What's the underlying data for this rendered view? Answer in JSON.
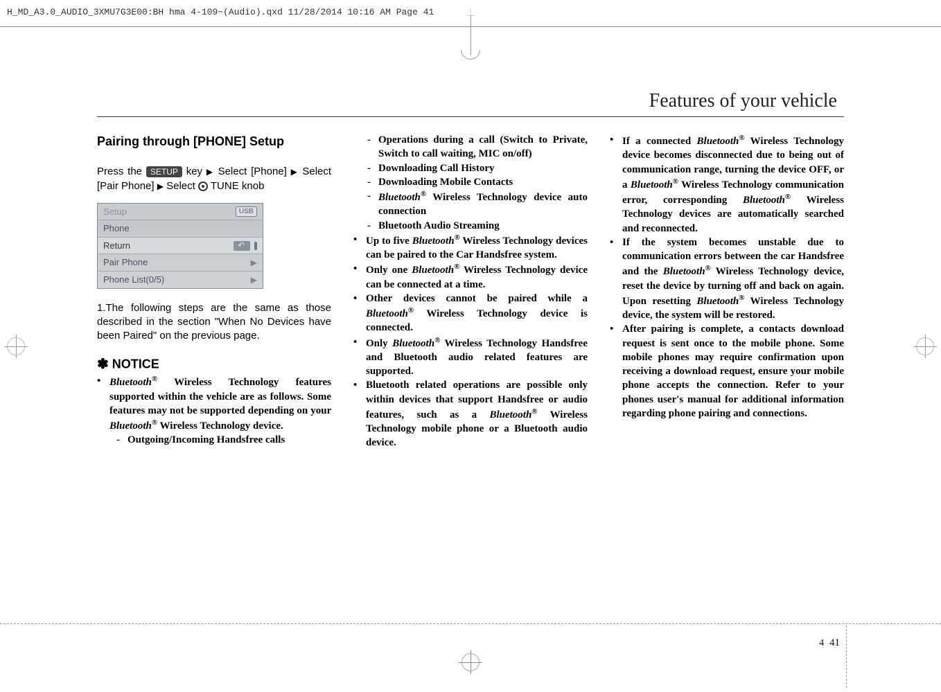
{
  "print_header": "H_MD_A3.0_AUDIO_3XMU7G3E00:BH hma 4-109~(Audio).qxd  11/28/2014  10:16 AM  Page 41",
  "section_title": "Features of your vehicle",
  "col1": {
    "heading": "Pairing through [PHONE] Setup",
    "press_pre": "Press the ",
    "setup_key": "SETUP",
    "press_after_key": " key ",
    "select1": "Select [Phone]",
    "select2": "Select [Pair Phone] ",
    "select3": "Select ",
    "tune_knob": "TUNE knob",
    "screenshot": {
      "title": "Setup",
      "usb": "USB",
      "phone": "Phone",
      "ret": "Return",
      "pair": "Pair Phone",
      "list": "Phone List(0/5)"
    },
    "step1": "1.The following steps are the same as those described in the section \"When No Devices have been Paired\" on the previous page.",
    "notice": "NOTICE",
    "b1_pre": "Bluetooth",
    "b1_post": " Wireless Technology features supported within the vehicle are as follows. Some features may not be supported depending on your ",
    "b1_bt2": "Bluetooth",
    "b1_tail": " Wireless Technology device.",
    "s1": "Outgoing/Incoming Handsfree calls"
  },
  "col2": {
    "s2": "Operations during a call (Switch to Private, Switch to call waiting, MIC on/off)",
    "s3": "Downloading Call History",
    "s4": "Downloading Mobile Contacts",
    "s5_pre": "Bluetooth",
    "s5_post": " Wireless Technology device auto connection",
    "s6": "Bluetooth Audio Streaming",
    "b2_pre": "Up to five ",
    "b2_bt": "Bluetooth",
    "b2_post": " Wireless Technology devices can be paired to the Car Handsfree system.",
    "b3_pre": "Only one ",
    "b3_bt": "Bluetooth",
    "b3_post": " Wireless Technology device can be connected at a time.",
    "b4_pre": "Other devices cannot be paired while a ",
    "b4_bt": "Bluetooth",
    "b4_post": " Wireless Technology device is connected.",
    "b5_pre": "Only ",
    "b5_bt": "Bluetooth",
    "b5_post": " Wireless Technology Handsfree and Bluetooth audio related features are supported.",
    "b6_pre": "Bluetooth related operations are possible only within devices that support Handsfree or audio features, such as a ",
    "b6_bt": "Bluetooth",
    "b6_post": " Wireless Technology mobile phone or a Bluetooth audio device."
  },
  "col3": {
    "b7_pre": "If a connected ",
    "b7_bt1": "Bluetooth",
    "b7_mid1": " Wireless Technology device becomes disconnected due to being out of communication range, turning the device OFF, or a ",
    "b7_bt2": "Bluetooth",
    "b7_mid2": " Wireless Technology communication error, corresponding ",
    "b7_bt3": "Bluetooth",
    "b7_post": " Wireless Technology devices are automatically searched and reconnected.",
    "b8_pre": "If the system becomes unstable due to communication errors between the car Handsfree and the ",
    "b8_bt1": "Bluetooth",
    "b8_mid1": " Wireless Technology device, reset the device by turning off and back on again. Upon resetting ",
    "b8_bt2": "Bluetooth",
    "b8_post": " Wireless Technology device, the system will be restored.",
    "b9": "After pairing is complete, a contacts download request is sent once to the mobile phone. Some mobile phones may require confirmation upon receiving a download request, ensure your mobile phone accepts the connection. Refer to your phones user's manual for additional information regarding phone pairing and connections."
  },
  "page": {
    "section": "4",
    "number": "41"
  }
}
